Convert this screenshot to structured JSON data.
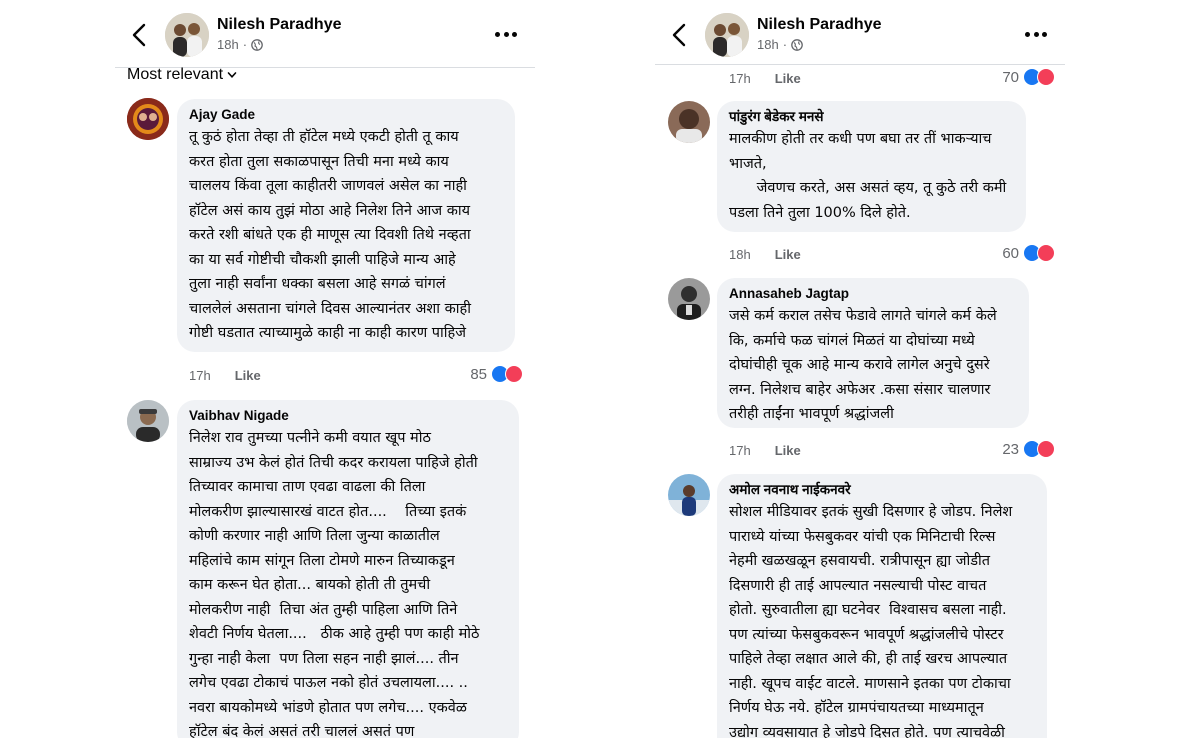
{
  "left": {
    "header": {
      "name": "Nilesh Paradhye",
      "time": "18h",
      "separator": "·"
    },
    "sort_label": "Most relevant",
    "comments": [
      {
        "name": "Ajay Gade",
        "lines": [
          "तू कुठं होता तेव्हा ती हॉटेल मध्ये एकटी होती तू काय",
          "करत होता तुला सकाळपासून तिची मना मध्ये काय",
          "चाललय किंवा तूला काहीतरी जाणवलं असेल का नाही",
          "हॉटेल असं काय तुझं मोठा आहे निलेश तिने आज काय",
          "करते रशी बांधते एक ही माणूस त्या दिवशी तिथे नव्हता",
          "का या सर्व गोष्टीची चौकशी झाली पाहिजे मान्य आहे",
          "तुला नाही सर्वांना धक्का बसला आहे सगळं चांगलं",
          "चाललेलं असताना चांगले दिवस आल्यानंतर अशा काही",
          "गोष्टी घडतात त्याच्यामुळे काही ना काही कारण पाहिजे"
        ],
        "time": "17h",
        "like": "Like",
        "reactions": "85"
      },
      {
        "name": "Vaibhav Nigade",
        "lines": [
          "निलेश राव तुमच्या पत्नीने कमी वयात खूप मोठ",
          "साम्राज्य उभ केलं होतं तिची कदर करायला पाहिजे होती",
          "तिच्यावर कामाचा ताण एवढा वाढला की तिला",
          "मोलकरीण झाल्यासारखं वाटत होत....    तिच्या इतकं",
          "कोणी करणार नाही आणि तिला जुन्या काळातील",
          "महिलांचे काम सांगून तिला टोमणे मारुन तिच्याकडून",
          "काम करून घेत होता... बायको होती ती तुमची",
          "मोलकरीण नाही  तिचा अंत तुम्ही पाहिला आणि तिने",
          "शेवटी निर्णय घेतला....   ठीक आहे तुम्ही पण काही मोठे",
          "गुन्हा नाही केला  पण तिला सहन नाही झालं.... तीन",
          "लगेच एवढा टोकाचं पाऊल नको होतं उचलायला.... ..",
          "नवरा बायकोमध्ये भांडणे होतात पण लगेच.... एकवेळ",
          "हॉटेल बंद केलं असतं तरी चाललं असतं पण"
        ]
      }
    ]
  },
  "right": {
    "header": {
      "name": "Nilesh Paradhye",
      "time": "18h",
      "separator": "·"
    },
    "top_actions": {
      "time": "17h",
      "like": "Like",
      "reactions": "70"
    },
    "comments": [
      {
        "name": "पांडुरंग बेडेकर मनसे",
        "lines": [
          "मालकीण होती तर कधी पण बघा तर तीं भाकऱ्याच",
          "भाजते,",
          "      जेवणच करते, अस असतं व्हय, तू कुठे तरी कमी",
          "पडला तिने तुला 100% दिले होते."
        ],
        "time": "18h",
        "like": "Like",
        "reactions": "60"
      },
      {
        "name": "Annasaheb Jagtap",
        "lines": [
          "जसे कर्म कराल तसेच फेडावे लागते चांगले कर्म केले",
          "कि, कर्माचे फळ चांगलं मिळतं या दोघांच्या मध्ये",
          "दोघांचीही चूक आहे मान्य करावे लागेल अनुचे दुसरे",
          "लग्न. निलेशच बाहेर अफेअर .कसा संसार चालणार",
          "तरीही ताईंना भावपूर्ण श्रद्धांजली"
        ],
        "time": "17h",
        "like": "Like",
        "reactions": "23"
      },
      {
        "name": "अमोल नवनाथ नाईकनवरे",
        "lines": [
          "सोशल मीडियावर इतकं सुखी दिसणार हे जोडप. निलेश",
          "पाराध्ये यांच्या फेसबुकवर यांची एक मिनिटाची रिल्स",
          "नेहमी खळखळून हसवायची. रात्रीपासून ह्या जोडीत",
          "दिसणारी ही ताई आपल्यात नसल्याची पोस्ट वाचत",
          "होतो. सुरुवातीला ह्या घटनेवर  विश्वासच बसला नाही.",
          "पण त्यांच्या फेसबुकवरून भावपूर्ण श्रद्धांजलीचे पोस्टर",
          "पाहिले तेव्हा लक्षात आले की, ही ताई खरच आपल्यात",
          "नाही. खूपच वाईट वाटले. माणसाने इतका पण टोकाचा",
          "निर्णय घेऊ नये. हॉटेल ग्रामपंचायतच्या माध्यमातून",
          "उद्योग व्यवसायात हे जोडपे दिसत होते. पण त्याचवेळी"
        ]
      }
    ]
  },
  "colors": {
    "like": "#1877f2",
    "love": "#f33e58",
    "bubble": "#f0f2f5",
    "meta": "#65676b"
  }
}
